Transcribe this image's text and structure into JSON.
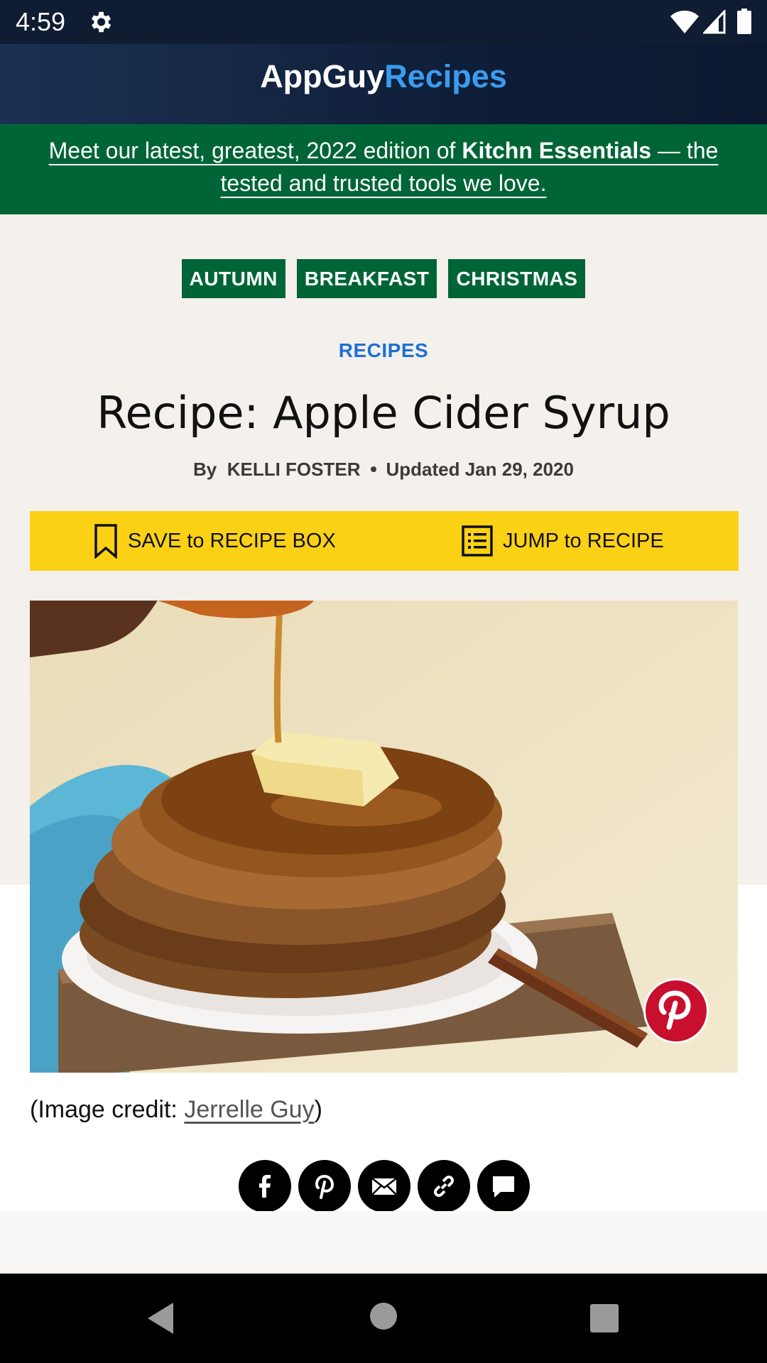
{
  "status_bar": {
    "time": "4:59",
    "icons": [
      "gear-icon",
      "wifi-icon",
      "cell-signal-icon",
      "battery-icon"
    ]
  },
  "app_bar": {
    "brand_part1": "AppGuy",
    "brand_part2": "Recipes"
  },
  "promo_banner": {
    "text_before": "Meet our latest, greatest, 2022 edition of ",
    "text_bold": "Kitchn Essentials",
    "text_after": " — the tested and trusted tools we love."
  },
  "article": {
    "tags": [
      "AUTUMN",
      "BREAKFAST",
      "CHRISTMAS"
    ],
    "category": "RECIPES",
    "title": "Recipe: Apple Cider Syrup",
    "by_prefix": "By",
    "author": "KELLI FOSTER",
    "updated": "Updated Jan 29, 2020"
  },
  "actions": {
    "save_label": "SAVE to RECIPE BOX",
    "jump_label": "JUMP to RECIPE"
  },
  "hero_image": {
    "description_icon": "pancakes-syrup-photo"
  },
  "credit": {
    "prefix": "(Image credit: ",
    "name": "Jerrelle Guy",
    "suffix": ")"
  },
  "share": [
    "facebook-icon",
    "pinterest-icon",
    "email-icon",
    "link-icon",
    "comment-icon"
  ],
  "colors": {
    "header": "#0f1c31",
    "brand_accent": "#3a9cf0",
    "promo_green": "#006536",
    "action_yellow": "#fbd116",
    "category_blue": "#1f6fd8",
    "pinterest_red": "#c8102e"
  }
}
